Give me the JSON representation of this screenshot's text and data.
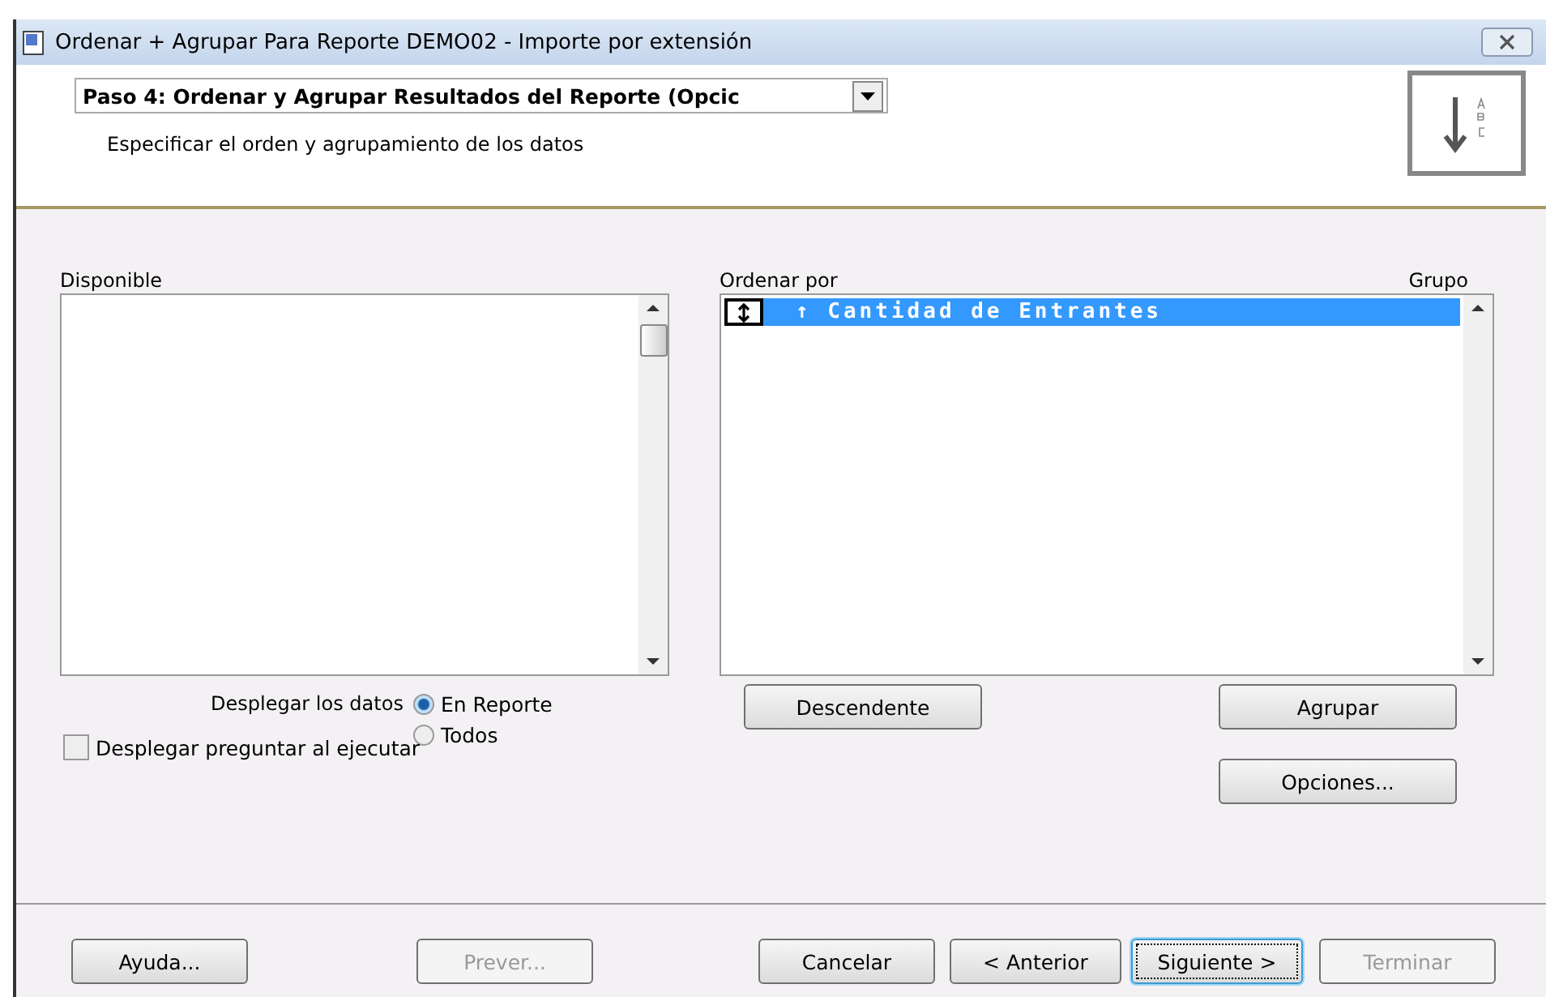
{
  "window": {
    "title": "Ordenar + Agrupar Para Reporte DEMO02 - Importe por extensión"
  },
  "step_selector": {
    "value": "Paso 4: Ordenar y Agrupar Resultados del Reporte (Opcic"
  },
  "subtitle": "Especificar el orden y agrupamiento de los datos",
  "available": {
    "label": "Disponible"
  },
  "sort": {
    "label": "Ordenar por",
    "group_label": "Grupo",
    "items": [
      {
        "text": "↑ Cantidad de Entrantes",
        "selected": true
      }
    ]
  },
  "display": {
    "label": "Desplegar los datos",
    "options": [
      {
        "label": "En Reporte",
        "selected": true
      },
      {
        "label": "Todos",
        "selected": false
      }
    ]
  },
  "prompt_checkbox": {
    "label": "Desplegar preguntar al ejecutar",
    "checked": false
  },
  "sort_buttons": {
    "descending": "Descendente",
    "group": "Agrupar",
    "options": "Opciones..."
  },
  "footer_buttons": [
    {
      "label": "Ayuda...",
      "disabled": false,
      "focused": false
    },
    {
      "label": "Prever...",
      "disabled": true,
      "focused": false
    },
    {
      "label": "Cancelar",
      "disabled": false,
      "focused": false
    },
    {
      "label": "< Anterior",
      "disabled": false,
      "focused": false
    },
    {
      "label": "Siguiente >",
      "disabled": false,
      "focused": true
    },
    {
      "label": "Terminar",
      "disabled": true,
      "focused": false
    }
  ]
}
